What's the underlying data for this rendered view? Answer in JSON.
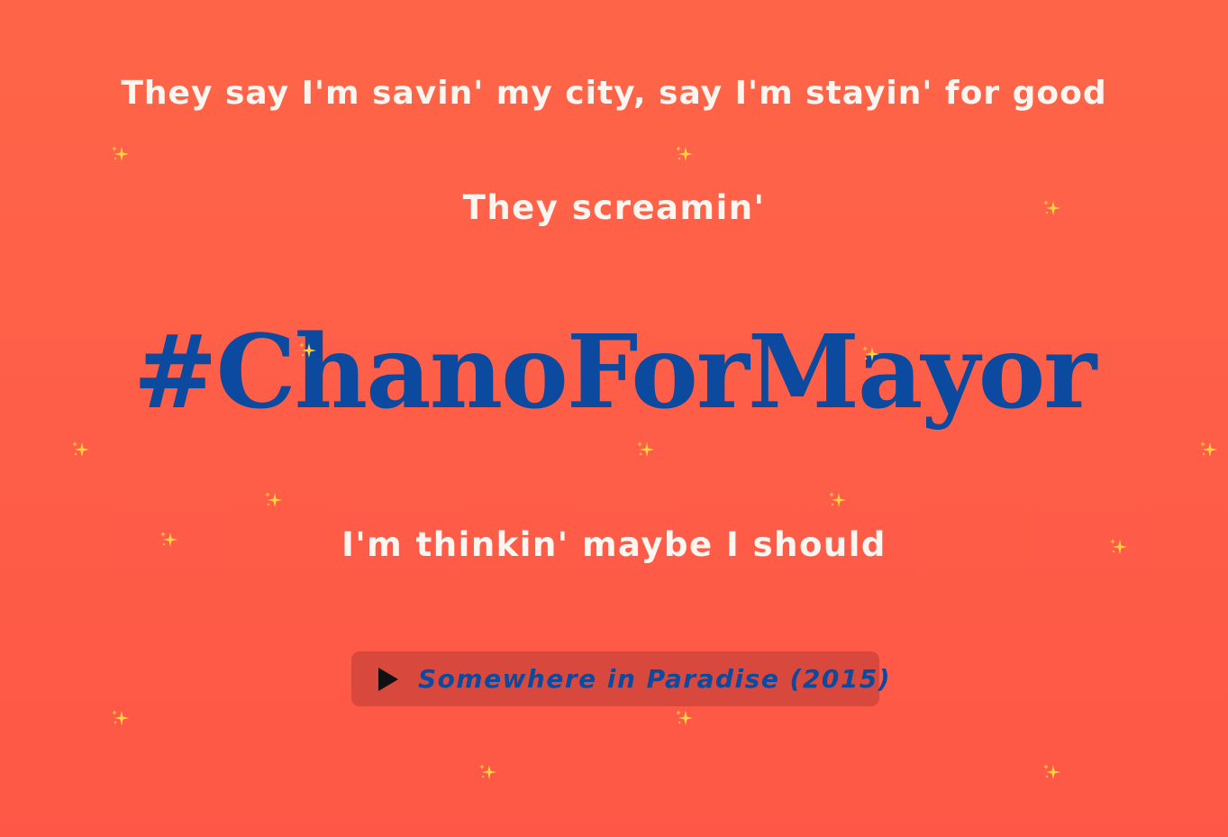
{
  "lyrics": {
    "line1": "They say I'm savin' my city, say I'm stayin' for good",
    "line2": "They screamin'",
    "hashtag": "#ChanoForMayor",
    "line3": "I'm thinkin' maybe I should"
  },
  "player": {
    "play_icon": "play-icon",
    "track_title": "Somewhere in Paradise (2015)"
  },
  "decoration": {
    "icon": "sparkle-icon",
    "color": "#ffd23f"
  },
  "colors": {
    "background_top": "#fe6548",
    "background_bottom": "#fe5747",
    "lyric_text": "#fdf5ef",
    "hashtag_text": "#0b4a9e",
    "player_background": "#d9483d"
  }
}
